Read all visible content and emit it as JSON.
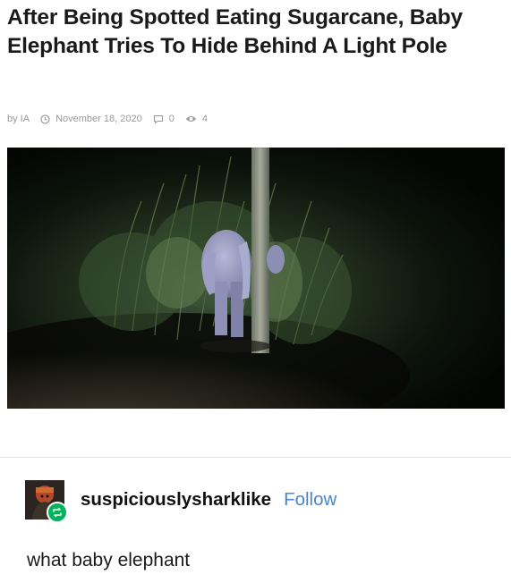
{
  "article": {
    "title": "After Being Spotted Eating Sugarcane, Baby Elephant Tries To Hide Behind A Light Pole",
    "author": "by IA",
    "date": "November 18, 2020",
    "comments": "0",
    "views": "4"
  },
  "photo": {
    "alt": ""
  },
  "post": {
    "username": "suspiciouslysharklike",
    "follow_label": "Follow",
    "text": "what baby elephant"
  },
  "icons": {
    "clock": "clock-icon",
    "comment": "comment-icon",
    "eye": "eye-icon",
    "reblog": "reblog-icon"
  },
  "colors": {
    "follow": "#4a86c8",
    "reblog_badge": "#00b35c"
  }
}
